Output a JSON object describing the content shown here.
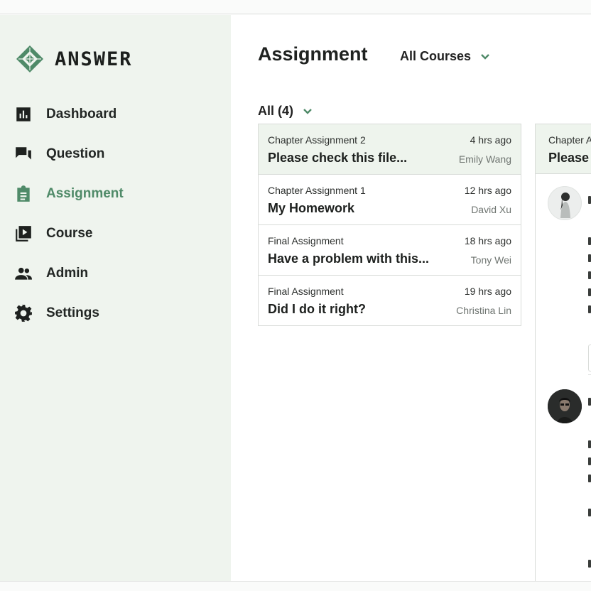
{
  "app": {
    "brand": "ANSWER"
  },
  "sidebar": {
    "items": [
      {
        "label": "Dashboard",
        "icon": "bar-chart-icon",
        "active": false
      },
      {
        "label": "Question",
        "icon": "chat-bubbles-icon",
        "active": false
      },
      {
        "label": "Assignment",
        "icon": "clipboard-icon",
        "active": true
      },
      {
        "label": "Course",
        "icon": "play-library-icon",
        "active": false
      },
      {
        "label": "Admin",
        "icon": "people-icon",
        "active": false
      },
      {
        "label": "Settings",
        "icon": "gear-icon",
        "active": false
      }
    ]
  },
  "header": {
    "title": "Assignment",
    "course_filter": "All Courses"
  },
  "list_filter": "All (4)",
  "assignments": [
    {
      "chapter": "Chapter Assignment 2",
      "time": "4 hrs ago",
      "subject": "Please check this file...",
      "author": "Emily Wang",
      "selected": true
    },
    {
      "chapter": "Chapter Assignment 1",
      "time": "12 hrs ago",
      "subject": "My Homework",
      "author": "David Xu",
      "selected": false
    },
    {
      "chapter": "Final Assignment",
      "time": "18 hrs ago",
      "subject": "Have a problem with this...",
      "author": "Tony Wei",
      "selected": false
    },
    {
      "chapter": "Final Assignment",
      "time": "19 hrs ago",
      "subject": "Did I do it right?",
      "author": "Christina Lin",
      "selected": false
    }
  ],
  "detail": {
    "chapter": "Chapter A",
    "subject": "Please"
  },
  "colors": {
    "accent": "#4f8a68",
    "sidebar_bg": "#eff4ee",
    "selected_row_bg": "#eef4ed",
    "border": "#d9dcd9"
  }
}
